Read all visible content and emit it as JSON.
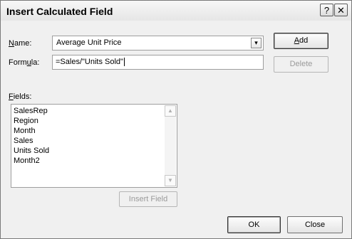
{
  "dialog": {
    "title": "Insert Calculated Field",
    "help_label": "?",
    "close_label": "✕"
  },
  "name": {
    "label_underlined": "N",
    "label_rest": "ame:",
    "value": "Average Unit Price",
    "dropdown_glyph": "▾"
  },
  "formula": {
    "label_start": "Form",
    "label_underlined": "u",
    "label_rest": "la:",
    "value": "=Sales/\"Units Sold\""
  },
  "buttons": {
    "add_underlined": "A",
    "add_rest": "dd",
    "delete": "Delete",
    "insert_field": "Insert Field",
    "ok": "OK",
    "close": "Close"
  },
  "fields": {
    "label_underlined": "F",
    "label_rest": "ields:",
    "items": [
      "SalesRep",
      "Region",
      "Month",
      "Sales",
      "Units Sold",
      "Month2"
    ],
    "scroll_up": "▲",
    "scroll_down": "▼"
  }
}
